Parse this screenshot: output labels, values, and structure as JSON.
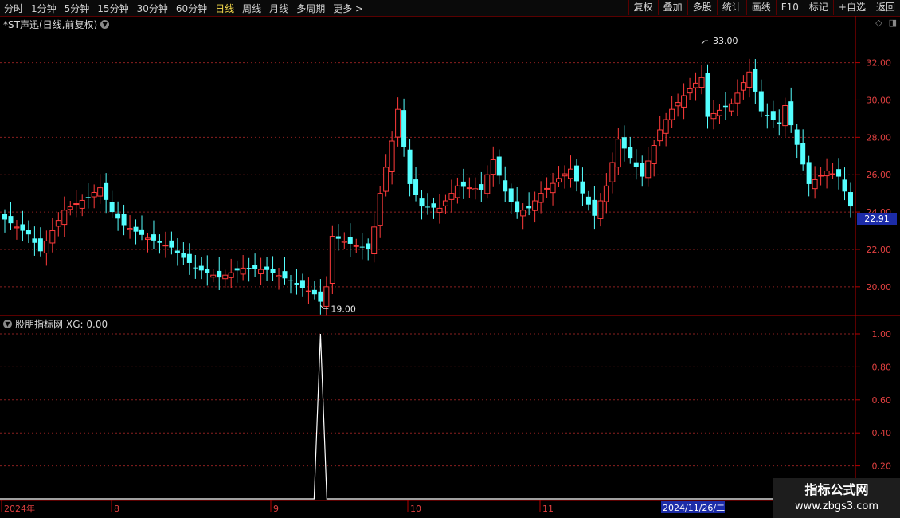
{
  "toolbar": {
    "periods": [
      "分时",
      "1分钟",
      "5分钟",
      "15分钟",
      "30分钟",
      "60分钟",
      "日线",
      "周线",
      "月线",
      "多周期",
      "更多 >"
    ],
    "active_period": "日线",
    "buttons": [
      "复权",
      "叠加",
      "多股",
      "统计",
      "画线",
      "F10",
      "标记",
      "+自选",
      "返回"
    ]
  },
  "chart": {
    "title": "*ST声迅(日线,前复权)",
    "high_label": "33.00",
    "low_label": "19.00",
    "current_price": "22.91",
    "y_ticks": [
      "32.00",
      "30.00",
      "28.00",
      "26.00",
      "24.00",
      "22.00",
      "20.00"
    ]
  },
  "indicator": {
    "title": "股朋指标网",
    "value_label": "XG: 0.00",
    "y_ticks": [
      "1.00",
      "0.80",
      "0.60",
      "0.40",
      "0.20"
    ]
  },
  "date_axis": {
    "labels": [
      "2024年",
      "8",
      "9",
      "10",
      "11"
    ],
    "highlight": "2024/11/26/二"
  },
  "watermark": {
    "brand": "指标公式网",
    "url": "www.zbgs3.com"
  },
  "colors": {
    "up": "#ff3b3b",
    "down": "#54ffff",
    "grid": "#8a1f1f",
    "axis": "#b40000"
  },
  "chart_data": {
    "type": "candlestick",
    "ylim": [
      18.5,
      34.5
    ],
    "indicator_series": {
      "name": "XG",
      "peak_value": 1.0
    }
  }
}
